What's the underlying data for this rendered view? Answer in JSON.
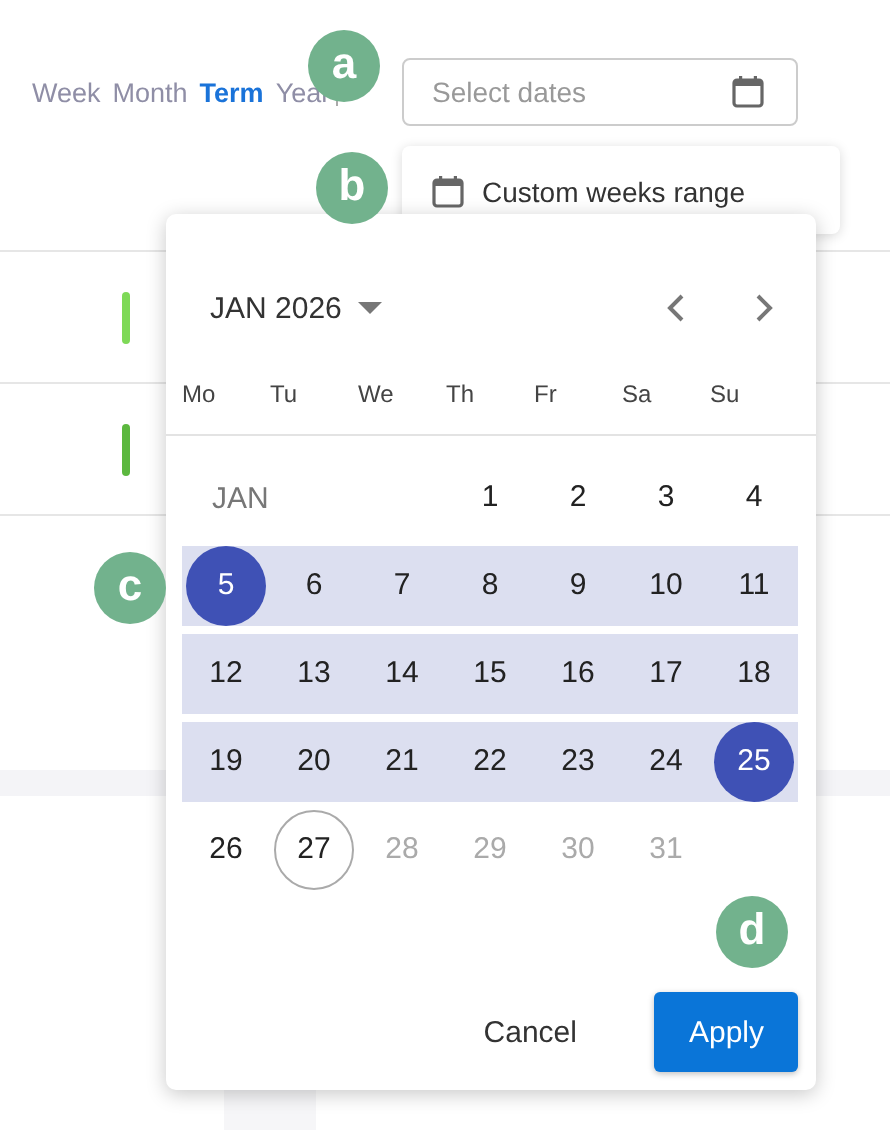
{
  "view_tabs": [
    {
      "label": "Week",
      "selected": false
    },
    {
      "label": "Month",
      "selected": false
    },
    {
      "label": "Term",
      "selected": true
    },
    {
      "label": "Year",
      "selected": false
    }
  ],
  "date_field": {
    "placeholder": "Select dates"
  },
  "range_menu": {
    "items": [
      {
        "label": "Custom weeks range"
      }
    ]
  },
  "list_rows": [
    {
      "color": "#7ed957"
    },
    {
      "color": "#5cb83f"
    }
  ],
  "calendar": {
    "month": "JAN 2026",
    "weekdays": [
      "Mo",
      "Tu",
      "We",
      "Th",
      "Fr",
      "Sa",
      "Su"
    ],
    "weeks": [
      {
        "month_label": "JAN",
        "days": [
          {
            "label": "1",
            "selected": false,
            "today": false,
            "disabled": false
          },
          {
            "label": "2",
            "selected": false,
            "today": false,
            "disabled": false
          },
          {
            "label": "3",
            "selected": false,
            "today": false,
            "disabled": false
          },
          {
            "label": "4",
            "selected": false,
            "today": false,
            "disabled": false
          }
        ]
      },
      {
        "in_range": true,
        "days": [
          {
            "label": "5",
            "selected": true,
            "today": false,
            "disabled": false
          },
          {
            "label": "6",
            "selected": false,
            "today": false,
            "disabled": false
          },
          {
            "label": "7",
            "selected": false,
            "today": false,
            "disabled": false
          },
          {
            "label": "8",
            "selected": false,
            "today": false,
            "disabled": false
          },
          {
            "label": "9",
            "selected": false,
            "today": false,
            "disabled": false
          },
          {
            "label": "10",
            "selected": false,
            "today": false,
            "disabled": false
          },
          {
            "label": "11",
            "selected": false,
            "today": false,
            "disabled": false
          }
        ]
      },
      {
        "in_range": true,
        "days": [
          {
            "label": "12",
            "selected": false,
            "today": false,
            "disabled": false
          },
          {
            "label": "13",
            "selected": false,
            "today": false,
            "disabled": false
          },
          {
            "label": "14",
            "selected": false,
            "today": false,
            "disabled": false
          },
          {
            "label": "15",
            "selected": false,
            "today": false,
            "disabled": false
          },
          {
            "label": "16",
            "selected": false,
            "today": false,
            "disabled": false
          },
          {
            "label": "17",
            "selected": false,
            "today": false,
            "disabled": false
          },
          {
            "label": "18",
            "selected": false,
            "today": false,
            "disabled": false
          }
        ]
      },
      {
        "in_range": true,
        "days": [
          {
            "label": "19",
            "selected": false,
            "today": false,
            "disabled": false
          },
          {
            "label": "20",
            "selected": false,
            "today": false,
            "disabled": false
          },
          {
            "label": "21",
            "selected": false,
            "today": false,
            "disabled": false
          },
          {
            "label": "22",
            "selected": false,
            "today": false,
            "disabled": false
          },
          {
            "label": "23",
            "selected": false,
            "today": false,
            "disabled": false
          },
          {
            "label": "24",
            "selected": false,
            "today": false,
            "disabled": false
          },
          {
            "label": "25",
            "selected": true,
            "today": false,
            "disabled": false
          }
        ]
      },
      {
        "days": [
          {
            "label": "26",
            "selected": false,
            "today": false,
            "disabled": false
          },
          {
            "label": "27",
            "selected": false,
            "today": true,
            "disabled": false
          },
          {
            "label": "28",
            "selected": false,
            "today": false,
            "disabled": true
          },
          {
            "label": "29",
            "selected": false,
            "today": false,
            "disabled": true
          },
          {
            "label": "30",
            "selected": false,
            "today": false,
            "disabled": true
          },
          {
            "label": "31",
            "selected": false,
            "today": false,
            "disabled": true
          }
        ]
      }
    ],
    "buttons": [
      {
        "label": "Cancel",
        "kind": "text"
      },
      {
        "label": "Apply",
        "kind": "primary"
      }
    ]
  },
  "callouts": [
    {
      "label": "a"
    },
    {
      "label": "b"
    },
    {
      "label": "c"
    },
    {
      "label": "d"
    }
  ]
}
